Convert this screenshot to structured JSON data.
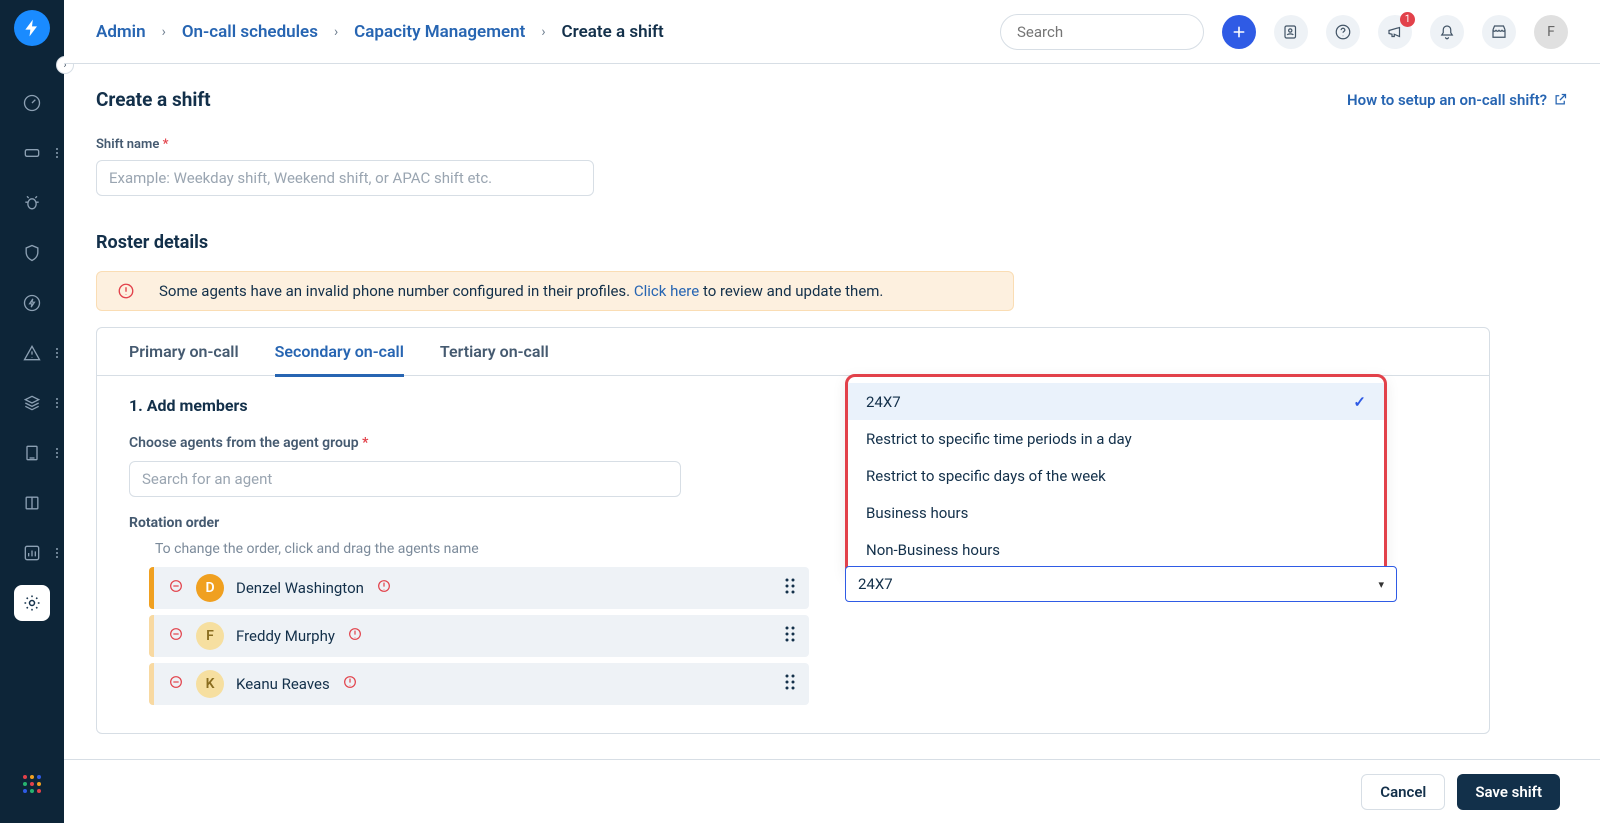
{
  "breadcrumbs": {
    "admin": "Admin",
    "schedules": "On-call schedules",
    "capacity": "Capacity Management",
    "current": "Create a shift"
  },
  "search": {
    "placeholder": "Search"
  },
  "header_icons": {
    "notif_badge": "1",
    "avatar_initial": "F"
  },
  "page": {
    "title": "Create a shift",
    "help": "How to setup an on-call shift?"
  },
  "shift_name": {
    "label": "Shift name",
    "placeholder": "Example: Weekday shift, Weekend shift, or APAC shift etc."
  },
  "roster": {
    "title": "Roster details",
    "alert_pre": "Some agents have an invalid phone number configured in their profiles. ",
    "alert_link": "Click here",
    "alert_post": " to review and update them."
  },
  "tabs": {
    "primary": "Primary on-call",
    "secondary": "Secondary on-call",
    "tertiary": "Tertiary on-call"
  },
  "members": {
    "heading": "1. Add members",
    "choose_label": "Choose agents from the agent group",
    "search_placeholder": "Search for an agent",
    "rotation_label": "Rotation order",
    "rotation_hint": "To change the order, click and drag the agents name",
    "rows": [
      {
        "initial": "D",
        "name": "Denzel Washington",
        "color": "#f0a020"
      },
      {
        "initial": "F",
        "name": "Freddy Murphy",
        "color": "#f6dfa0"
      },
      {
        "initial": "K",
        "name": "Keanu Reaves",
        "color": "#f6dfa0"
      }
    ]
  },
  "dropdown": {
    "options": [
      "24X7",
      "Restrict to specific time periods in a day",
      "Restrict to specific days of the week",
      "Business hours",
      "Non-Business hours"
    ],
    "selected": "24X7"
  },
  "footer": {
    "cancel": "Cancel",
    "save": "Save shift"
  }
}
